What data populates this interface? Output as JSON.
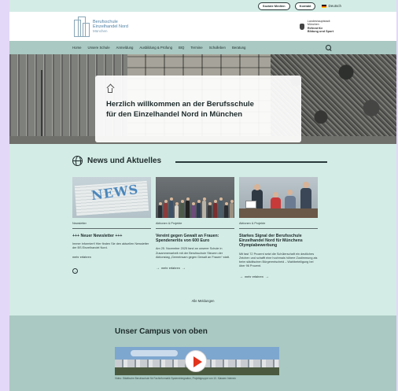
{
  "utility": {
    "social": "Soziale Medien",
    "contact": "Kontakt",
    "language": "Deutsch"
  },
  "header": {
    "logo_line1": "Berufsschule",
    "logo_line2": "Einzelhandel Nord",
    "logo_line3": "München",
    "ministry_line1": "Landeshauptstadt",
    "ministry_line2": "München",
    "ministry_line3": "Referat für",
    "ministry_line4": "Bildung und Sport"
  },
  "nav": {
    "items": [
      "Home",
      "Unsere Schule",
      "Anmeldung",
      "Ausbildung & Prüfung",
      "BIQ",
      "Termine",
      "Schulleben",
      "Beratung"
    ]
  },
  "hero": {
    "title": "Herzlich willkommen an der Berufsschule für den Einzelhandel Nord in München"
  },
  "news": {
    "heading": "News und Aktuelles",
    "all_link": "Alle Meldungen",
    "cards": [
      {
        "image_text": "NEWS",
        "category": "Newsletter",
        "title": "+++ Neuer Newsletter +++",
        "text": "Immer informiert! Hier finden Sie den aktuellen Newsletter der BS Einzelhandel Nord.",
        "more": "mehr erfahren"
      },
      {
        "category": "Aktionen & Projekte",
        "title": "Vereint gegen Gewalt an Frauen: Spendenerlös von 600 Euro",
        "text": "Am 25. November 2025 fand an unserer Schule in Zusammenarbeit mit der Berufsschule Steuern der Aktionstag „Gemeinsam gegen Gewalt an Frauen“ statt.",
        "more": "mehr erfahren"
      },
      {
        "category": "Aktionen & Projekte",
        "title": "Starkes Signal der Berufsschule Einzelhandel Nord für Münchens Olympiabewerbung",
        "text": "Mit fast 72 Prozent setzt die Schülerschaft ein deutliches Zeichen und schafft eine hochmals höhere Zustimmung als beim städtischen Bürgerentscheid – Wahlbeteiligung bei über 96 Prozent.",
        "more": "mehr erfahren"
      }
    ]
  },
  "campus": {
    "heading": "Unser Campus von oben",
    "caption": "Video: Städtische Berufsschule für Fachinformatik Systemintegration, Projektgruppe von 10. Klassen Intensiv"
  },
  "colors": {
    "page_bg": "#d4ece6",
    "nav_bg": "#a9c9c2",
    "frame": "#e3d8f7",
    "play_red": "#e2341d"
  }
}
